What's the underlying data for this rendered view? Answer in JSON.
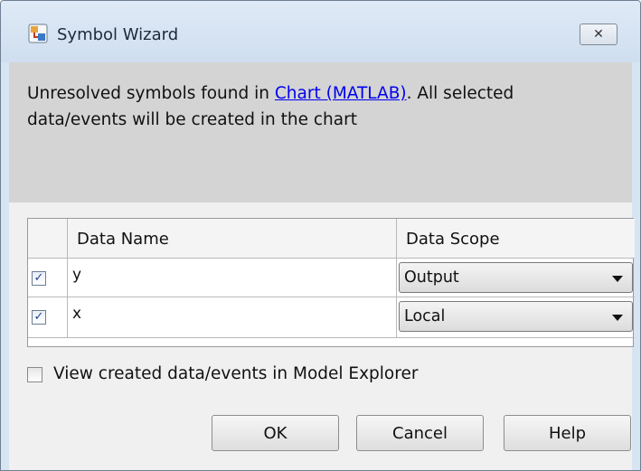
{
  "window": {
    "title": "Symbol Wizard",
    "close_glyph": "✕",
    "icon": "stateflow-app-icon"
  },
  "message": {
    "prefix": "Unresolved symbols found in ",
    "link": "Chart (MATLAB)",
    "suffix": ". All selected data/events will be created in the chart"
  },
  "table": {
    "columns": [
      "",
      "Data Name",
      "Data Scope"
    ],
    "rows": [
      {
        "checked": true,
        "name": "y",
        "scope": "Output"
      },
      {
        "checked": true,
        "name": "x",
        "scope": "Local"
      }
    ]
  },
  "view_option": {
    "label": "View created data/events in Model Explorer",
    "checked": false
  },
  "buttons": {
    "ok": "OK",
    "cancel": "Cancel",
    "help": "Help"
  },
  "check_glyph": "✓",
  "colors": {
    "titlebar": "#d7e4f2",
    "message_bg": "#d4d4d4",
    "link": "#0000ee"
  }
}
